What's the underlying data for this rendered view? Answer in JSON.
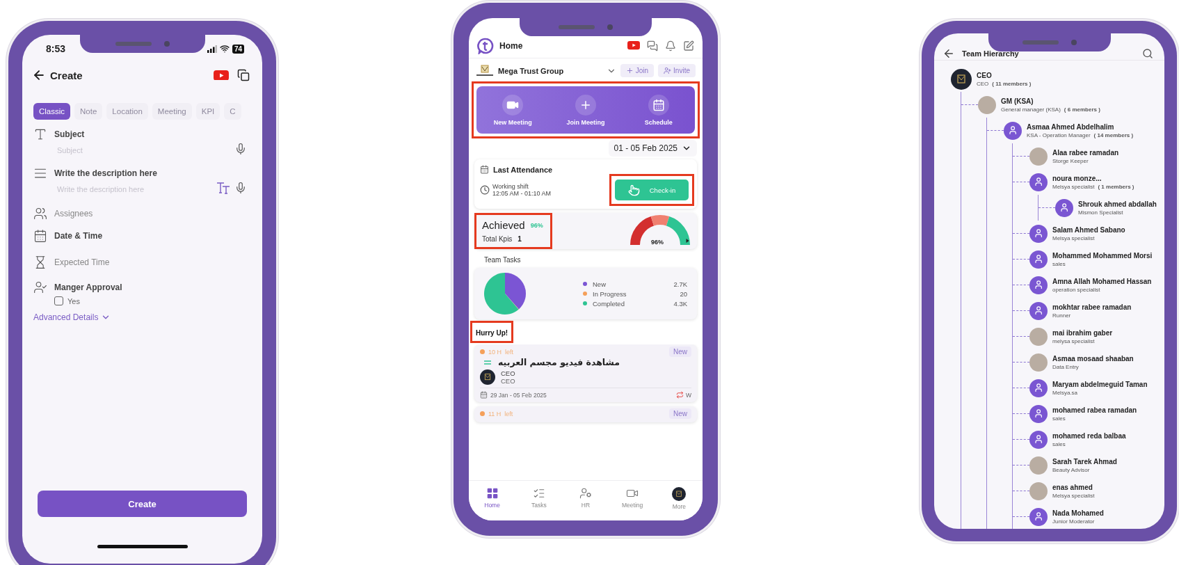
{
  "create_screen": {
    "status_time": "8:53",
    "battery": "74",
    "title": "Create",
    "tabs": [
      {
        "label": "Classic",
        "selected": true
      },
      {
        "label": "Note",
        "selected": false
      },
      {
        "label": "Location",
        "selected": false
      },
      {
        "label": "Meeting",
        "selected": false
      },
      {
        "label": "KPI",
        "selected": false
      },
      {
        "label": "C",
        "selected": false
      }
    ],
    "fields": [
      {
        "kind": "text",
        "label": "Subject",
        "placeholder": "Subject"
      },
      {
        "kind": "rich_text",
        "label": "Write the description here",
        "placeholder": "Write the description here"
      },
      {
        "kind": "option",
        "label": "Assignees"
      },
      {
        "kind": "heading",
        "label": "Date & Time"
      },
      {
        "kind": "option",
        "label": "Expected Time"
      },
      {
        "kind": "approval",
        "label": "Manger Approval",
        "checkbox": {
          "label": "Yes",
          "checked": false
        }
      }
    ],
    "advanced_link": "Advanced Details",
    "submit_button": "Create"
  },
  "home_screen": {
    "title": "Home",
    "organization": "Mega Trust Group",
    "join_button": "Join",
    "invite_button": "Invite",
    "quick_actions": {
      "highlighted": true,
      "items": [
        "New Meeting",
        "Join Meeting",
        "Schedule"
      ]
    },
    "date_range": "01 - 05 Feb 2025",
    "attendance": {
      "title": "Last Attendance",
      "shift_label": "Working shift",
      "shift_time": "12:05 AM - 01:10 AM",
      "check_in": {
        "label": "Check-in",
        "highlighted": true
      }
    },
    "kpi": {
      "highlighted": true,
      "label": "Achieved",
      "percent": "96%",
      "total_label": "Total Kpis",
      "total": "1",
      "gauge_reading": "96%",
      "level": 0.96
    },
    "team_tasks": {
      "title": "Team Tasks",
      "legend": [
        {
          "value": "2.7K",
          "color": "#7b55d4"
        },
        {
          "value": "20",
          "color": "#f5a05a"
        },
        {
          "value": "4.3K",
          "color": "#2ec493"
        }
      ],
      "chart_data": {
        "type": "pie",
        "categories": [
          "New",
          "In Progress",
          "Completed"
        ],
        "values": [
          38.4,
          0.3,
          61.3
        ]
      }
    },
    "hurry_up": {
      "title": "Hurry Up!",
      "highlighted": true,
      "tasks": [
        {
          "time_left": "10 H  left",
          "badge": "New",
          "title": "مشاهدة فيديو مجسم العربيه",
          "assignee_name": "CEO",
          "assignee_role": "CEO",
          "dates": "29 Jan - 05 Feb 2025",
          "repeat": "W"
        },
        {
          "time_left": "11 H  left",
          "badge": "New"
        }
      ]
    },
    "nav": [
      {
        "label": "Home",
        "selected": true
      },
      {
        "label": "Tasks",
        "selected": false
      },
      {
        "label": "HR",
        "selected": false
      },
      {
        "label": "Meeting",
        "selected": false
      },
      {
        "label": "More",
        "selected": false
      }
    ]
  },
  "hierarchy_screen": {
    "title": "Team Hierarchy",
    "tree": [
      {
        "name": "CEO",
        "role": "CEO",
        "members": "( 11 members )",
        "kind": "logo",
        "children": [
          {
            "name": "GM (KSA)",
            "role": "General manager (KSA)",
            "members": "( 6 members )",
            "kind": "photo",
            "children": [
              {
                "name": "Asmaa Ahmed Abdelhalim",
                "role": "KSA -  Operation Manager",
                "members": "( 14 members )",
                "kind": "default",
                "children": [
                  {
                    "name": "Alaa rabee ramadan",
                    "role": "Storge Keeper",
                    "kind": "photo"
                  },
                  {
                    "name": "noura monze...",
                    "role": "Melsya specialist",
                    "members": "( 1 members )",
                    "kind": "default",
                    "children": [
                      {
                        "name": "Shrouk ahmed abdallah",
                        "role": "Mismon Specialist",
                        "kind": "default"
                      }
                    ]
                  },
                  {
                    "name": "Salam Ahmed Sabano",
                    "role": "Melsya specialist",
                    "kind": "default"
                  },
                  {
                    "name": "Mohammed Mohammed Morsi",
                    "role": "sales",
                    "kind": "default"
                  },
                  {
                    "name": "Amna Allah Mohamed Hassan",
                    "role": "operation specialist",
                    "kind": "default"
                  },
                  {
                    "name": "mokhtar rabee ramadan",
                    "role": "Runner",
                    "kind": "default"
                  },
                  {
                    "name": "mai ibrahim gaber",
                    "role": "melysa specialist",
                    "kind": "photo"
                  },
                  {
                    "name": "Asmaa mosaad shaaban",
                    "role": "Data Entry",
                    "kind": "photo"
                  },
                  {
                    "name": "Maryam abdelmeguid Taman",
                    "role": "Melsya.sa",
                    "kind": "default"
                  },
                  {
                    "name": "mohamed rabea ramadan",
                    "role": "sales",
                    "kind": "default"
                  },
                  {
                    "name": "mohamed reda balbaa",
                    "role": "sales",
                    "kind": "default"
                  },
                  {
                    "name": "Sarah Tarek Ahmad",
                    "role": "Beauty Advisor",
                    "kind": "photo"
                  },
                  {
                    "name": "enas ahmed",
                    "role": "Melsya specialist",
                    "kind": "photo"
                  },
                  {
                    "name": "Nada Mohamed",
                    "role": "Junior Moderator",
                    "kind": "default"
                  }
                ]
              }
            ]
          }
        ]
      }
    ]
  }
}
